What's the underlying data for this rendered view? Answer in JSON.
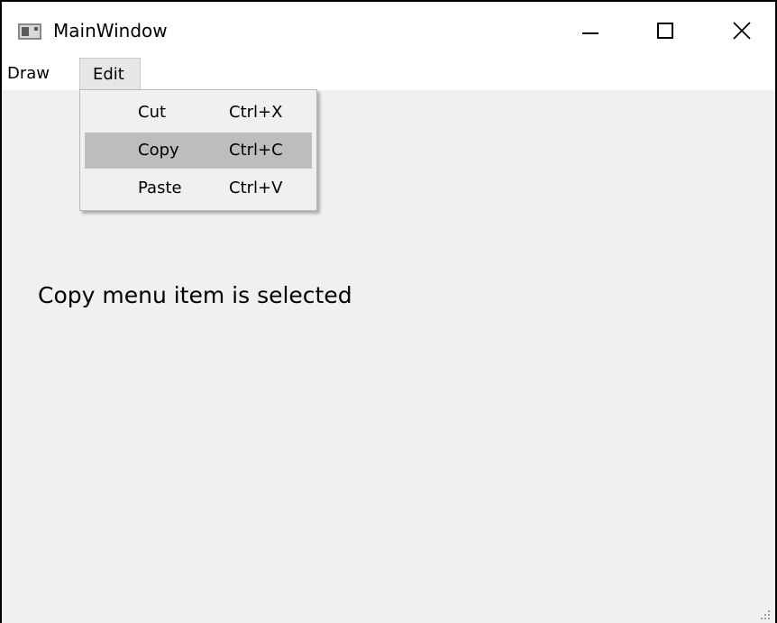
{
  "window": {
    "title": "MainWindow"
  },
  "controls": {
    "minimize_icon": "minimize-icon",
    "maximize_icon": "maximize-icon",
    "close_icon": "close-icon"
  },
  "menubar": {
    "items": [
      {
        "label": "Draw"
      },
      {
        "label": "Edit"
      }
    ]
  },
  "edit_menu": {
    "items": [
      {
        "label": "Cut",
        "shortcut": "Ctrl+X"
      },
      {
        "label": "Copy",
        "shortcut": "Ctrl+C",
        "selected": true
      },
      {
        "label": "Paste",
        "shortcut": "Ctrl+V"
      }
    ]
  },
  "main": {
    "status_text": "Copy menu item is selected"
  },
  "colors": {
    "window_bg": "#f0f0f0",
    "selection_bg": "#bdbdbd",
    "titlebar_bg": "#ffffff"
  }
}
